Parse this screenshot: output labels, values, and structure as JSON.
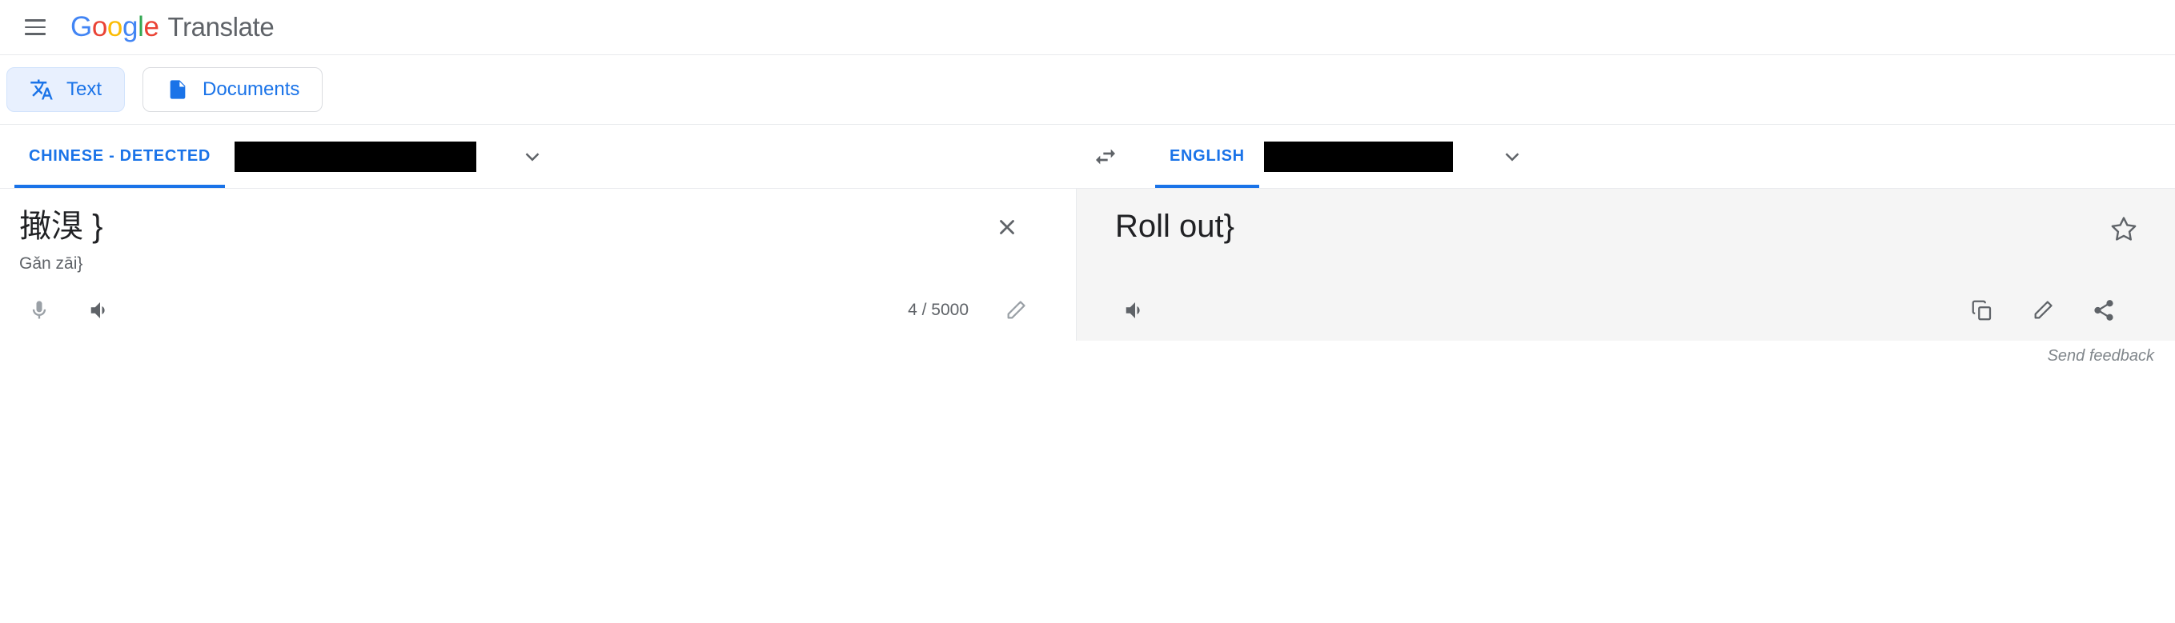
{
  "header": {
    "menu_icon": "hamburger-menu-icon",
    "logo_letters": [
      "G",
      "o",
      "o",
      "g",
      "l",
      "e"
    ],
    "product_name": "Translate"
  },
  "tabs": [
    {
      "label": "Text",
      "icon": "translate-icon",
      "active": true
    },
    {
      "label": "Documents",
      "icon": "document-icon",
      "active": false
    }
  ],
  "language_bar": {
    "source": {
      "label": "CHINESE - DETECTED",
      "selected": true,
      "redacted": true,
      "chevron_icon": "chevron-down-icon"
    },
    "swap_icon": "swap-languages-icon",
    "target": {
      "label": "ENGLISH",
      "selected": true,
      "redacted": true,
      "chevron_icon": "chevron-down-icon"
    }
  },
  "source_panel": {
    "text": "撖湨 }",
    "romanization": "Gǎn zāi}",
    "clear_icon": "close-icon",
    "mic_icon": "microphone-icon",
    "speaker_icon": "speaker-icon",
    "char_count": "4 / 5000",
    "edit_icon": "pencil-icon"
  },
  "target_panel": {
    "text": "Roll out}",
    "star_icon": "star-outline-icon",
    "speaker_icon": "speaker-icon",
    "copy_icon": "copy-icon",
    "edit_icon": "pencil-icon",
    "share_icon": "share-icon"
  },
  "footer": {
    "send_feedback": "Send feedback"
  },
  "colors": {
    "accent": "#1a73e8",
    "tab_active_bg": "#e8f0fe",
    "target_panel_bg": "#f5f5f5",
    "redaction": "#000000",
    "muted_text": "#5f6368",
    "google_blue": "#4285F4",
    "google_red": "#EA4335",
    "google_yellow": "#FBBC05",
    "google_green": "#34A853"
  }
}
